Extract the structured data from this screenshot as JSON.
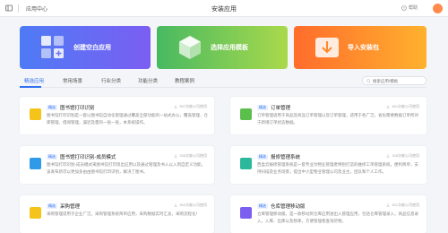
{
  "topbar": {
    "crumb": "应用中心",
    "title": "安装应用",
    "help": "帮助"
  },
  "banners": [
    {
      "label": "创建空白应用",
      "icon": "grid-plus-icon"
    },
    {
      "label": "选择应用模板",
      "icon": "cube-icon"
    },
    {
      "label": "导入安装包",
      "icon": "download-icon"
    }
  ],
  "tabs": [
    "精选应用",
    "常用场景",
    "行业分类",
    "功能分类",
    "教程案例"
  ],
  "search": {
    "placeholder": "搜索应用/模板"
  },
  "cards": [
    {
      "title": "图书馆打印识别",
      "badge": "精选",
      "desc": "图书馆打印识别是一套以图书馆自动化管理通过覆盖全部功能的一站式办公，覆盖管理、仓库管理、借阅管理，逼近及量的一张一张，本系统操作。",
      "count": "557次被公司使用",
      "color": "#f5c41b"
    },
    {
      "title": "订单管理",
      "badge": "精选",
      "desc": "订单管理适用于商品及商品订单管理以及订单管理，适用于各广泛，省份需要数据订单所对于新增订单状态数据。",
      "count": "461次被公司使用",
      "color": "#5bbf4c"
    },
    {
      "title": "图书馆打印识别-成员模式",
      "badge": "精选",
      "desc": "图书馆打印识别-成员模式来图书馆打印现出应用以及通过管理及书入以入到自定义功能，该发布新可以更加多由由图书馆打印识别，解决了图书。",
      "count": "336次被公司使用",
      "color": "#2f9be8"
    },
    {
      "title": "报修管理系统",
      "badge": "精选",
      "desc": "西盒云报修管理系统是一套专业为物业管理者特别打造的维修工单管理系统，便利简单，支持扫描及业务场景，提出中小型物业管理公司及业主，团队和个人工作。",
      "count": "326次被公司使用",
      "color": "#2cb89a"
    },
    {
      "title": "采购管理",
      "badge": "精选",
      "desc": "采购管理适用于企业广泛，采购管理系统简单应用，采购数据实时汇总，采购流程化！",
      "count": "302次被公司使用",
      "color": "#f5c41b"
    },
    {
      "title": "仓库管理移动版",
      "badge": "精选",
      "desc": "仓库管理移动版，是一款移动到仓库应用进出入管理应用，包括仓库管理录入，商品信息录入，入库、出库以及移库，方便管理者查询货物。",
      "count": "301次被公司使用",
      "color": "#7a5ff0"
    }
  ]
}
